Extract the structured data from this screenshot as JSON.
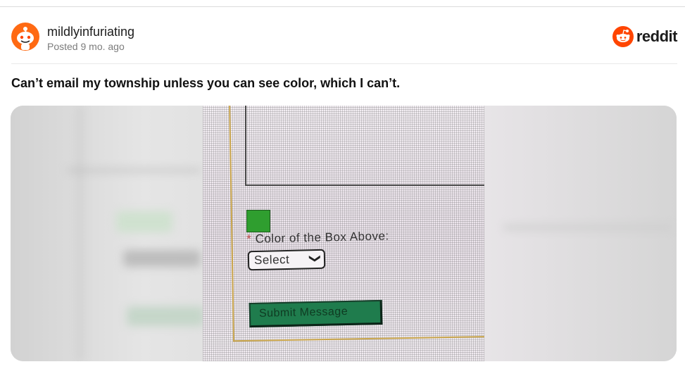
{
  "post": {
    "subreddit": "mildlyinfuriating",
    "posted": "Posted 9 mo. ago",
    "title": "Can’t email my township unless you can see color, which I can’t."
  },
  "brand": {
    "name": "reddit",
    "icon": "reddit-logo-icon",
    "accent": "#ff4500"
  },
  "photo": {
    "color_label_required": "*",
    "color_label": "Color of the Box Above:",
    "select_value": "Select",
    "submit_label": "Submit Message",
    "box_color": "#2f9e2f"
  }
}
